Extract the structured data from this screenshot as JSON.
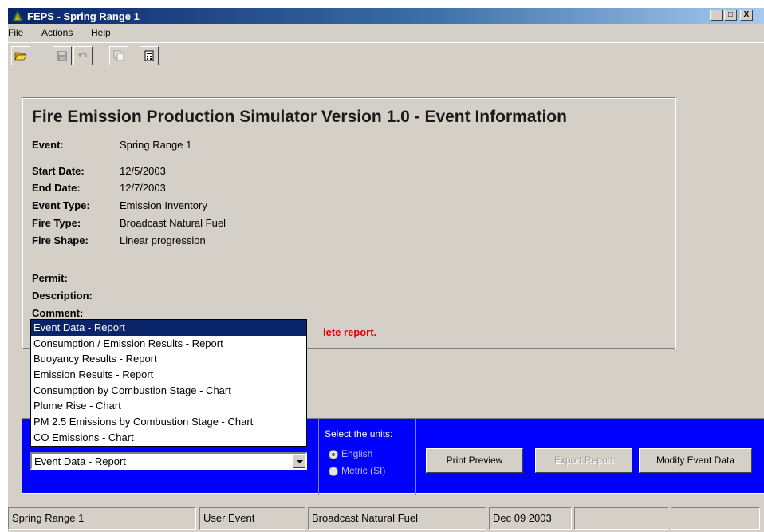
{
  "window": {
    "title": "FEPS - Spring Range 1",
    "controls": {
      "minimize": "_",
      "maximize": "□",
      "close": "X"
    }
  },
  "menu": [
    "File",
    "Actions",
    "Help"
  ],
  "toolbar": {
    "buttons": [
      {
        "icon": "open-folder-icon",
        "enabled": true
      },
      {
        "icon": "save-disk-icon",
        "enabled": false
      },
      {
        "icon": "undo-icon",
        "enabled": false
      },
      {
        "icon": "copy-icon",
        "enabled": false
      },
      {
        "icon": "calculator-icon",
        "enabled": true
      }
    ]
  },
  "event_info": {
    "heading": "Fire Emission Production Simulator Version 1.0 - Event Information",
    "event_label": "Event:",
    "event_value": "Spring Range 1",
    "start_date_label": "Start Date:",
    "start_date_value": "12/5/2003",
    "end_date_label": "End Date:",
    "end_date_value": "12/7/2003",
    "event_type_label": "Event Type:",
    "event_type_value": "Emission Inventory",
    "fire_type_label": "Fire Type:",
    "fire_type_value": "Broadcast Natural Fuel",
    "fire_shape_label": "Fire Shape:",
    "fire_shape_value": "Linear progression",
    "permit_label": "Permit:",
    "description_label": "Description:",
    "comment_label": "Comment:",
    "red_message_visible": "lete report."
  },
  "report_select": {
    "selected": "Event Data - Report",
    "options": [
      "Event Data - Report",
      "Consumption / Emission Results - Report",
      "Buoyancy Results - Report",
      "Emission Results - Report",
      "Consumption by Combustion Stage - Chart",
      "Plume Rise - Chart",
      "PM 2.5 Emissions by Combustion Stage - Chart",
      "CO Emissions - Chart"
    ]
  },
  "units": {
    "label": "Select the units:",
    "english": "English",
    "metric": "Metric (SI)",
    "selected": "English"
  },
  "buttons": {
    "print_preview": "Print Preview",
    "export_report": "Export Report",
    "modify_event": "Modify Event Data"
  },
  "status_bar": [
    "Spring Range 1",
    "User Event",
    "Broadcast Natural Fuel",
    "Dec 09 2003",
    "",
    ""
  ],
  "colors": {
    "panel_blue": "#0000ff",
    "title_blue": "#0a246a",
    "error_red": "#e00000",
    "selection_blue": "#0a246a"
  }
}
